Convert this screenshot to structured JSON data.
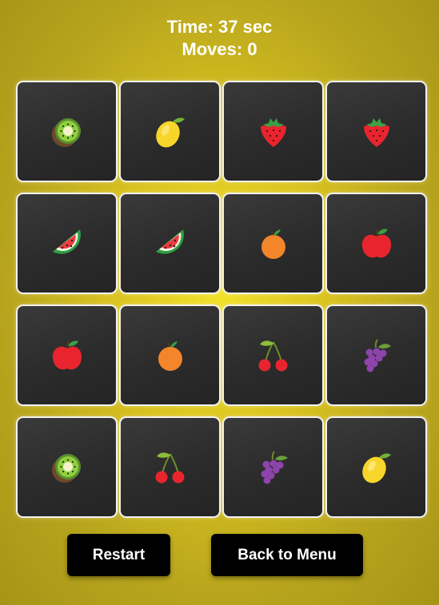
{
  "hud": {
    "time_text": "Time: 37 sec",
    "moves_text": "Moves: 0"
  },
  "cards": [
    {
      "fruit": "kiwi"
    },
    {
      "fruit": "lemon"
    },
    {
      "fruit": "strawberry"
    },
    {
      "fruit": "strawberry"
    },
    {
      "fruit": "watermelon"
    },
    {
      "fruit": "watermelon"
    },
    {
      "fruit": "orange"
    },
    {
      "fruit": "apple"
    },
    {
      "fruit": "apple"
    },
    {
      "fruit": "orange"
    },
    {
      "fruit": "cherries"
    },
    {
      "fruit": "grapes"
    },
    {
      "fruit": "kiwi"
    },
    {
      "fruit": "cherries"
    },
    {
      "fruit": "grapes"
    },
    {
      "fruit": "lemon"
    }
  ],
  "buttons": {
    "restart_label": "Restart",
    "menu_label": "Back to Menu"
  }
}
